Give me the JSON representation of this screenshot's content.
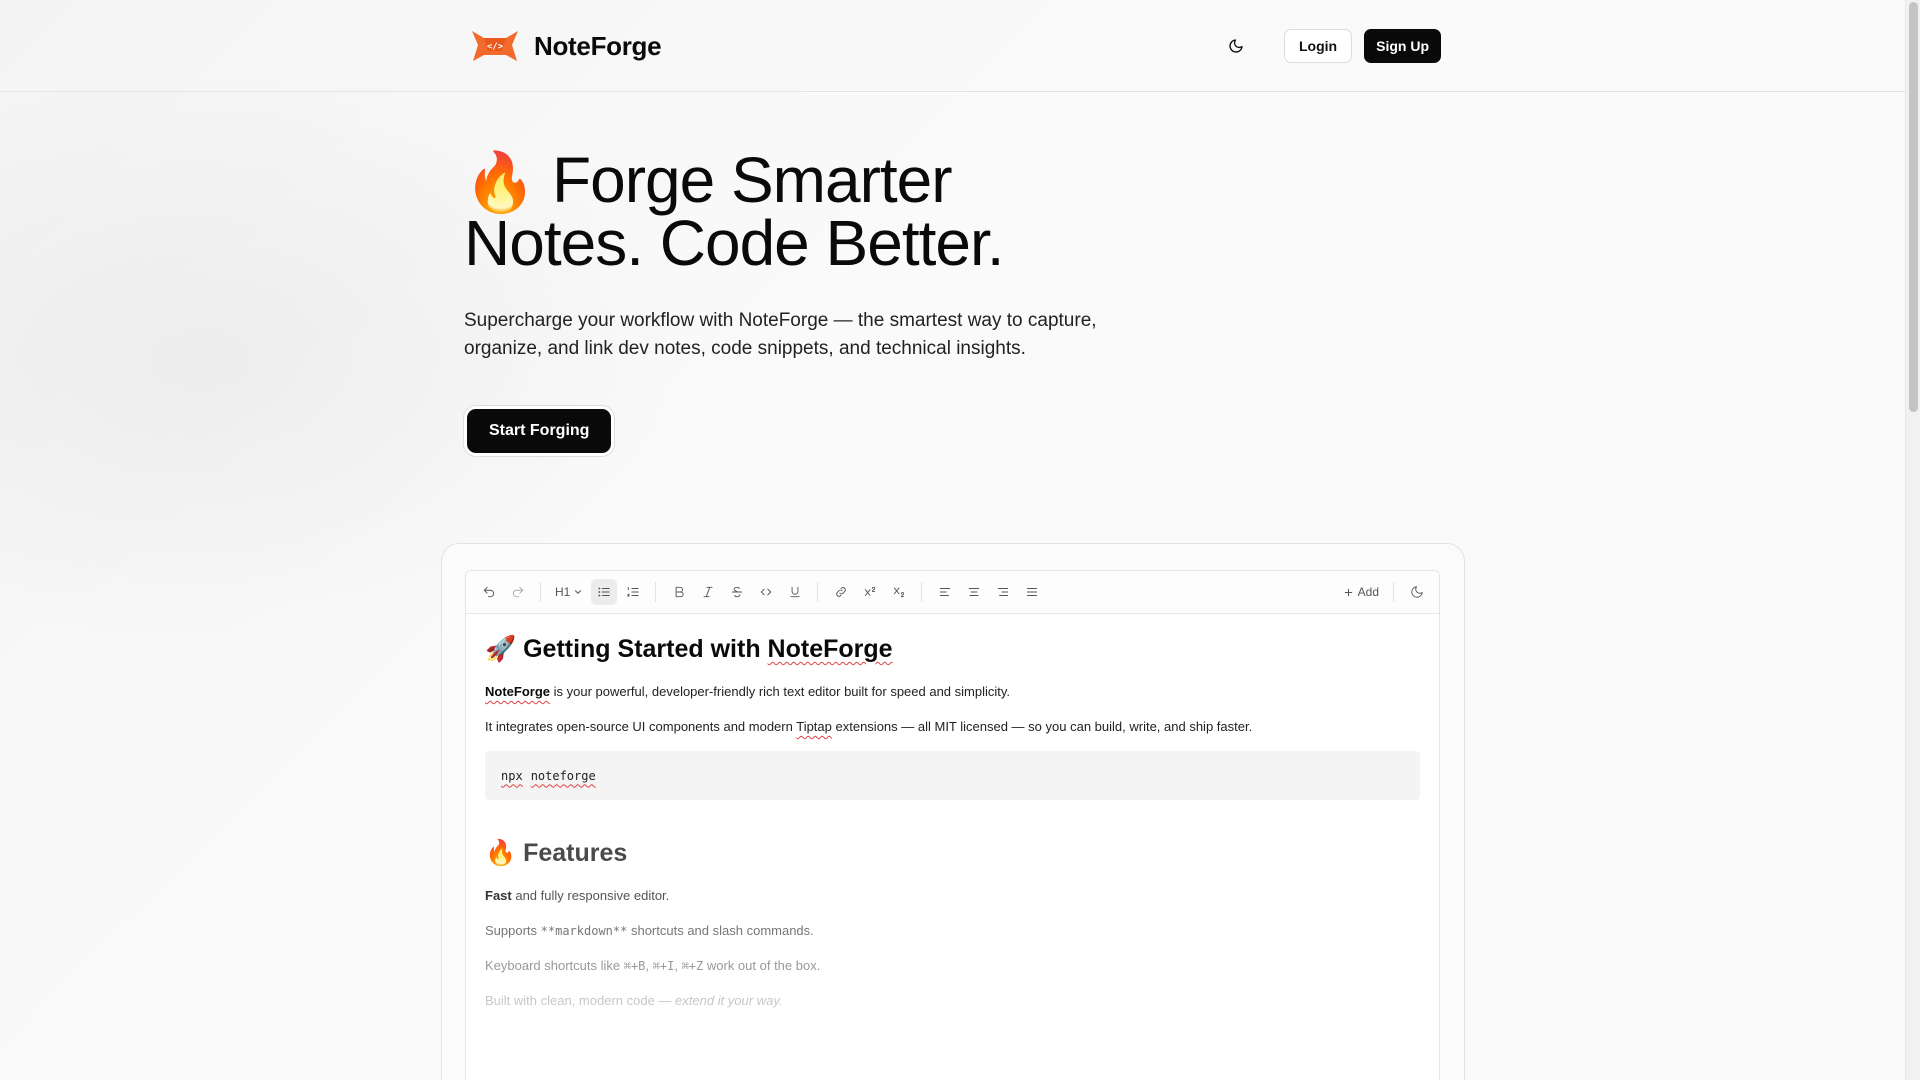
{
  "header": {
    "brand_name": "NoteForge",
    "login_label": "Login",
    "signup_label": "Sign Up"
  },
  "hero": {
    "emoji": "🔥",
    "title_line1": "Forge Smarter",
    "title_line2": "Notes. Code Better.",
    "subtitle": "Supercharge your workflow with NoteForge — the smartest way to capture, organize, and link dev notes, code snippets, and technical insights.",
    "cta_label": "Start Forging"
  },
  "toolbar": {
    "heading_label": "H1",
    "add_label": "Add"
  },
  "doc": {
    "h1_emoji": "🚀",
    "h1_text": "Getting Started with ",
    "h1_brand": "NoteForge",
    "p1_brand": "NoteForge",
    "p1_rest": " is your powerful, developer-friendly rich text editor built for speed and simplicity.",
    "p2_start": "It integrates open-source UI components and modern ",
    "p2_tiptap": "Tiptap",
    "p2_end": " extensions — all MIT licensed — so you can build, write, and ship faster.",
    "code_cmd": "npx",
    "code_arg": "noteforge",
    "h2_emoji": "🔥",
    "h2_text": "Features",
    "f1_bold": "Fast",
    "f1_rest": " and fully responsive editor.",
    "f2_start": "Supports ",
    "f2_code": "**markdown**",
    "f2_end": " shortcuts and slash commands.",
    "f3_start": "Keyboard shortcuts like ",
    "f3_k1": "⌘+B",
    "f3_sep1": ", ",
    "f3_k2": "⌘+I",
    "f3_sep2": ", ",
    "f3_k3": "⌘+Z",
    "f3_end": " work out of the box.",
    "f4_start": "Built with clean, modern code — ",
    "f4_italic": "extend it your way."
  },
  "icons": {
    "theme": "moon-icon",
    "logo": "fox-code-logo"
  },
  "colors": {
    "primary": "#0a0a0a",
    "logo_orange": "#f26b2c",
    "spell_error": "#e04444"
  }
}
